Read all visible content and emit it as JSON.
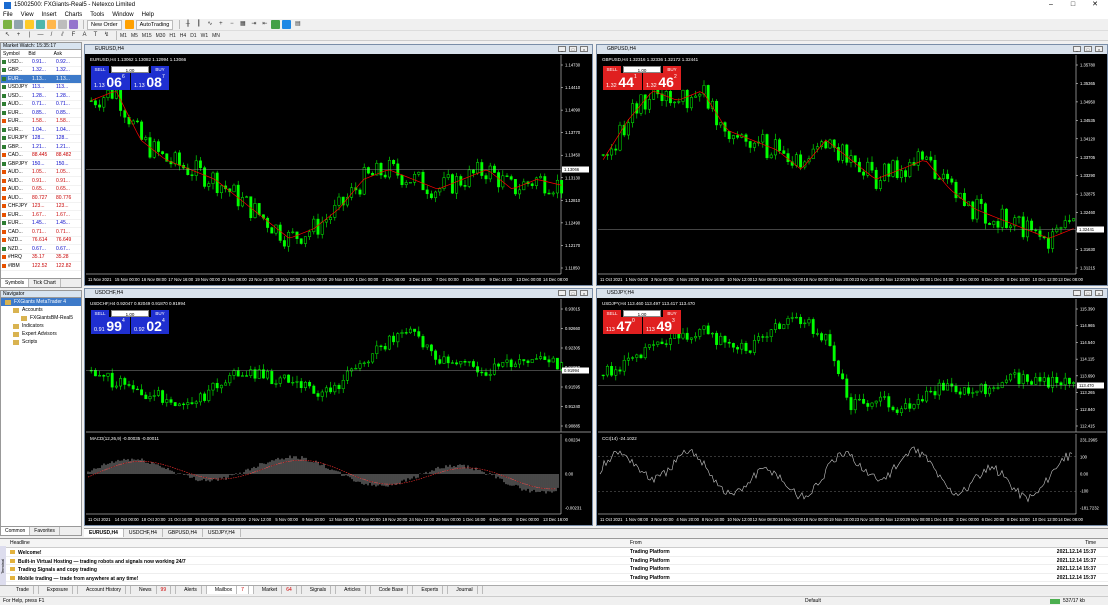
{
  "window": {
    "title": "15002500: FXGiants-Real5 - Netexco Limited",
    "minimize": "–",
    "maximize": "□",
    "close": "✕"
  },
  "menu": [
    "File",
    "View",
    "Insert",
    "Charts",
    "Tools",
    "Window",
    "Help"
  ],
  "toolbar": {
    "new_order": "New Order",
    "autotrading": "AutoTrading",
    "timeframes": [
      "M1",
      "M5",
      "M15",
      "M30",
      "H1",
      "H4",
      "D1",
      "W1",
      "MN"
    ]
  },
  "market_watch": {
    "title": "Market Watch: 15:35:17",
    "col_symbol": "Symbol",
    "col_bid": "Bid",
    "col_ask": "Ask",
    "rows": [
      {
        "symbol": "USD...",
        "bid": "0.91...",
        "ask": "0.92...",
        "dir": "up"
      },
      {
        "symbol": "GBP...",
        "bid": "1.32...",
        "ask": "1.32...",
        "dir": "up"
      },
      {
        "symbol": "EUR...",
        "bid": "1.13...",
        "ask": "1.13...",
        "dir": "up",
        "selected": true
      },
      {
        "symbol": "USDJPY",
        "bid": "113...",
        "ask": "113...",
        "dir": "up"
      },
      {
        "symbol": "USD...",
        "bid": "1.28...",
        "ask": "1.28...",
        "dir": "up"
      },
      {
        "symbol": "AUD...",
        "bid": "0.71...",
        "ask": "0.71...",
        "dir": "up"
      },
      {
        "symbol": "EUR...",
        "bid": "0.85...",
        "ask": "0.85...",
        "dir": "up"
      },
      {
        "symbol": "EUR...",
        "bid": "1.58...",
        "ask": "1.58...",
        "dir": "dn"
      },
      {
        "symbol": "EUR...",
        "bid": "1.04...",
        "ask": "1.04...",
        "dir": "up"
      },
      {
        "symbol": "EURJPY",
        "bid": "128...",
        "ask": "128...",
        "dir": "up"
      },
      {
        "symbol": "GBP...",
        "bid": "1.21...",
        "ask": "1.21...",
        "dir": "up"
      },
      {
        "symbol": "CAD...",
        "bid": "88.445",
        "ask": "88.482",
        "dir": "dn"
      },
      {
        "symbol": "GBPJPY",
        "bid": "150...",
        "ask": "150...",
        "dir": "up"
      },
      {
        "symbol": "AUD...",
        "bid": "1.05...",
        "ask": "1.05...",
        "dir": "dn"
      },
      {
        "symbol": "AUD...",
        "bid": "0.91...",
        "ask": "0.91...",
        "dir": "dn"
      },
      {
        "symbol": "AUD...",
        "bid": "0.65...",
        "ask": "0.65...",
        "dir": "dn"
      },
      {
        "symbol": "AUD...",
        "bid": "80.727",
        "ask": "80.776",
        "dir": "dn"
      },
      {
        "symbol": "CHFJPY",
        "bid": "123...",
        "ask": "123...",
        "dir": "dn"
      },
      {
        "symbol": "EUR...",
        "bid": "1.67...",
        "ask": "1.67...",
        "dir": "dn"
      },
      {
        "symbol": "EUR...",
        "bid": "1.45...",
        "ask": "1.45...",
        "dir": "up"
      },
      {
        "symbol": "CAD...",
        "bid": "0.71...",
        "ask": "0.71...",
        "dir": "dn"
      },
      {
        "symbol": "NZD...",
        "bid": "76.614",
        "ask": "76.649",
        "dir": "dn"
      },
      {
        "symbol": "NZD...",
        "bid": "0.67...",
        "ask": "0.67...",
        "dir": "up"
      },
      {
        "symbol": "#HRQ",
        "bid": "35.17",
        "ask": "35.28",
        "dir": "dn"
      },
      {
        "symbol": "#IBM",
        "bid": "122.52",
        "ask": "122.82",
        "dir": "dn"
      }
    ],
    "tabs": [
      "Symbols",
      "Tick Chart"
    ]
  },
  "navigator": {
    "title": "Navigator",
    "items": [
      {
        "label": "FXGiants MetaTrader 4",
        "level": 0,
        "selected": true
      },
      {
        "label": "Accounts",
        "level": 1
      },
      {
        "label": "FXGiantsBM-Real5",
        "level": 2
      },
      {
        "label": "Indicators",
        "level": 1
      },
      {
        "label": "Expert Advisors",
        "level": 1
      },
      {
        "label": "Scripts",
        "level": 1
      }
    ],
    "tabs": [
      "Common",
      "Favorites"
    ]
  },
  "charts": [
    {
      "caption": "EURUSD,H4",
      "info": "EURUSD,H4  1.13062 1.13082 1.12994 1.13066",
      "sell_label": "SELL",
      "buy_label": "BUY",
      "lot": "1.00",
      "sell_prefix": "1.13",
      "sell_big": "06",
      "sell_sup": "6",
      "buy_prefix": "1.13",
      "buy_big": "08",
      "buy_sup": "7",
      "panel_color": "#1f2fd0",
      "price_labels": [
        "1.14730",
        "1.14410",
        "1.14090",
        "1.13770",
        "1.13450",
        "1.13130",
        "1.12810",
        "1.12490",
        "1.12170",
        "1.11850"
      ],
      "current_price": "1.13066",
      "time_labels": [
        "11 Nov 2021",
        "15 Nov 00:00",
        "16 Nov 08:00",
        "17 Nov 16:00",
        "19 Nov 00:00",
        "22 Nov 08:00",
        "23 Nov 16:00",
        "25 Nov 00:00",
        "26 Nov 08:00",
        "29 Nov 16:00",
        "1 Dec 00:00",
        "2 Dec 08:00",
        "3 Dec 16:00",
        "7 Dec 00:00",
        "8 Dec 08:00",
        "9 Dec 16:00",
        "13 Dec 00:00",
        "14 Dec 08:00"
      ],
      "line_color": "#00ff00",
      "ma_color": "#ff0000"
    },
    {
      "caption": "GBPUSD,H4",
      "info": "GBPUSD,H4  1.32316 1.32336 1.32172 1.32441",
      "sell_label": "SELL",
      "buy_label": "BUY",
      "lot": "1.00",
      "sell_prefix": "1.32",
      "sell_big": "44",
      "sell_sup": "1",
      "buy_prefix": "1.32",
      "buy_big": "46",
      "buy_sup": "2",
      "panel_color": "#e02020",
      "price_labels": [
        "1.35780",
        "1.35365",
        "1.34950",
        "1.34535",
        "1.34120",
        "1.33705",
        "1.33290",
        "1.32875",
        "1.32460",
        "1.32045",
        "1.31630",
        "1.31215"
      ],
      "current_price": "1.32441",
      "time_labels": [
        "11 Oct 2021",
        "1 Nov 04:00",
        "3 Nov 00:00",
        "4 Nov 20:00",
        "8 Nov 16:00",
        "10 Nov 12:00",
        "12 Nov 08:00",
        "16 Nov 04:00",
        "18 Nov 00:00",
        "19 Nov 20:00",
        "23 Nov 16:00",
        "25 Nov 12:00",
        "29 Nov 08:00",
        "1 Dec 04:00",
        "3 Dec 00:00",
        "6 Dec 20:00",
        "8 Dec 16:00",
        "10 Dec 12:00",
        "13 Dec 08:00"
      ],
      "line_color": "#00ff00",
      "ma_color": "#ff0000"
    },
    {
      "caption": "USDCHF,H4",
      "info": "USDCHF,H4  0.92047 0.92049 0.91870 0.91994",
      "sell_label": "SELL",
      "buy_label": "BUY",
      "lot": "1.00",
      "sell_prefix": "0.91",
      "sell_big": "99",
      "sell_sup": "4",
      "buy_prefix": "0.92",
      "buy_big": "02",
      "buy_sup": "4",
      "panel_color": "#1f2fd0",
      "price_labels": [
        "0.93015",
        "0.92660",
        "0.92305",
        "0.91950",
        "0.91595",
        "0.91240",
        "0.90885"
      ],
      "current_price": "0.91994",
      "time_labels": [
        "11 Oct 2021",
        "14 Oct 00:00",
        "18 Oct 20:00",
        "21 Oct 16:00",
        "26 Oct 00:00",
        "28 Oct 20:00",
        "2 Nov 12:00",
        "5 Nov 00:00",
        "9 Nov 20:00",
        "12 Nov 08:00",
        "17 Nov 00:00",
        "19 Nov 20:00",
        "24 Nov 12:00",
        "29 Nov 00:00",
        "1 Dec 16:00",
        "6 Dec 08:00",
        "9 Dec 00:00",
        "13 Dec 16:00"
      ],
      "line_color": "#00ff00",
      "indicator_info": "MACD(12,26,9) -0.00035 -0.00011",
      "indicator_labels": [
        "0.00234",
        "0.00",
        "-0.00231"
      ],
      "indicator_type": "macd"
    },
    {
      "caption": "USDJPY,H4",
      "info": "USDJPY,H4  113.460 113.497 113.417 113.470",
      "sell_label": "SELL",
      "buy_label": "BUY",
      "lot": "1.00",
      "sell_prefix": "113",
      "sell_big": "47",
      "sell_sup": "0",
      "buy_prefix": "113",
      "buy_big": "49",
      "buy_sup": "3",
      "panel_color": "#e02020",
      "price_labels": [
        "115.390",
        "114.965",
        "114.540",
        "114.115",
        "113.690",
        "113.265",
        "112.840",
        "112.415"
      ],
      "current_price": "113.470",
      "time_labels": [
        "11 Oct 2021",
        "1 Nov 08:00",
        "3 Nov 00:00",
        "4 Nov 20:00",
        "8 Nov 16:00",
        "10 Nov 12:00",
        "12 Nov 08:00",
        "16 Nov 04:00",
        "18 Nov 00:00",
        "19 Nov 20:00",
        "23 Nov 16:00",
        "25 Nov 12:00",
        "29 Nov 08:00",
        "1 Dec 04:00",
        "3 Dec 00:00",
        "6 Dec 20:00",
        "8 Dec 16:00",
        "10 Dec 12:00",
        "14 Dec 08:00"
      ],
      "line_color": "#00ff00",
      "indicator_info": "CCI(14) -24.1022",
      "indicator_labels": [
        "231.2965",
        "100",
        "0.00",
        "-100",
        "-181.7232"
      ],
      "indicator_type": "cci"
    }
  ],
  "chart_tabs": [
    "EURUSD,H4",
    "USDCHF,H4",
    "GBPUSD,H4",
    "USDJPY,H4"
  ],
  "terminal": {
    "col_headline": "Headline",
    "col_from": "From",
    "col_time": "Time",
    "rows": [
      {
        "headline": "Welcome!",
        "from": "Trading Platform",
        "time": "2021.12.14 15:37"
      },
      {
        "headline": "Built-in Virtual Hosting — trading robots and signals now working 24/7",
        "from": "Trading Platform",
        "time": "2021.12.14 15:37"
      },
      {
        "headline": "Trading Signals and copy trading",
        "from": "Trading Platform",
        "time": "2021.12.14 15:37"
      },
      {
        "headline": "Mobile trading — trade from anywhere at any time!",
        "from": "Trading Platform",
        "time": "2021.12.14 15:37"
      }
    ],
    "tabs": [
      {
        "label": "Trade"
      },
      {
        "label": "Exposure"
      },
      {
        "label": "Account History"
      },
      {
        "label": "News",
        "badge": "99"
      },
      {
        "label": "Alerts"
      },
      {
        "label": "Mailbox",
        "badge": "7",
        "active": true
      },
      {
        "label": "Market",
        "badge": "64"
      },
      {
        "label": "Signals"
      },
      {
        "label": "Articles"
      },
      {
        "label": "Code Base"
      },
      {
        "label": "Experts"
      },
      {
        "label": "Journal"
      }
    ],
    "side_label": "Terminal"
  },
  "status": {
    "help": "For Help, press F1",
    "profile": "Default",
    "traffic": "537/17 kb"
  }
}
